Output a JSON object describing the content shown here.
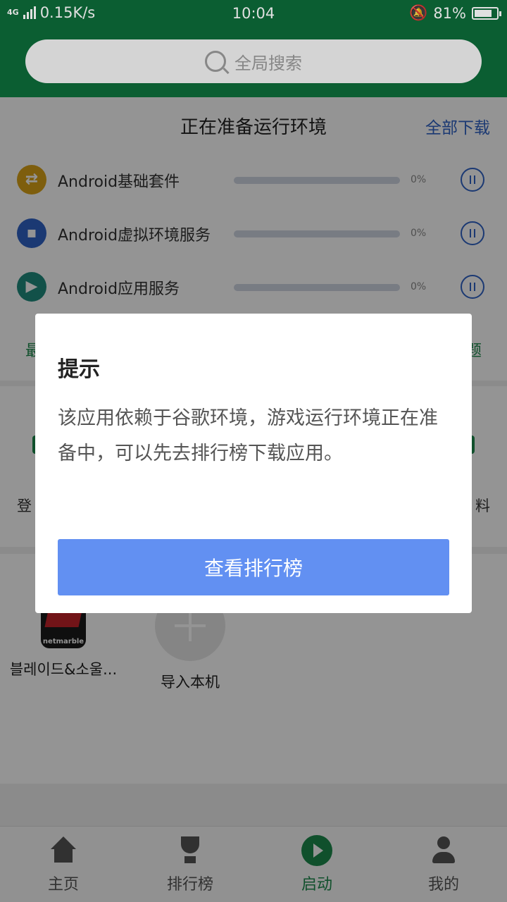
{
  "status_bar": {
    "network": "4G",
    "speed": "0.15K/s",
    "time": "10:04",
    "battery": "81%",
    "battery_level": 0.81
  },
  "search": {
    "placeholder": "全局搜索"
  },
  "env": {
    "title": "正在准备运行环境",
    "download_all": "全部下载",
    "items": [
      {
        "name": "Android基础套件",
        "progress": "0%",
        "progress_value": 0,
        "icon": "swap-arrows-icon",
        "color": "#d9a318"
      },
      {
        "name": "Android虚拟环境服务",
        "progress": "0%",
        "progress_value": 0,
        "icon": "box-icon",
        "color": "#2f63c6"
      },
      {
        "name": "Android应用服务",
        "progress": "0%",
        "progress_value": 0,
        "icon": "play-store-icon",
        "color": "#1f8c7e"
      }
    ],
    "partial_left": "最",
    "partial_right": "题"
  },
  "functions": {
    "partial_left": "登",
    "partial_right": "料"
  },
  "apps": [
    {
      "label": "블레이드&소울...",
      "icon_text": "netmarble"
    },
    {
      "label": "导入本机"
    }
  ],
  "dialog": {
    "title": "提示",
    "message": "该应用依赖于谷歌环境，游戏运行环境正在准备中，可以先去排行榜下载应用。",
    "button": "查看排行榜"
  },
  "nav": {
    "items": [
      {
        "label": "主页",
        "icon": "home-icon"
      },
      {
        "label": "排行榜",
        "icon": "trophy-icon"
      },
      {
        "label": "启动",
        "icon": "play-icon",
        "active": true
      },
      {
        "label": "我的",
        "icon": "person-icon"
      }
    ]
  },
  "colors": {
    "brand_green": "#0d6b3a",
    "accent_blue": "#2f63c6",
    "button_blue": "#6290f2"
  }
}
